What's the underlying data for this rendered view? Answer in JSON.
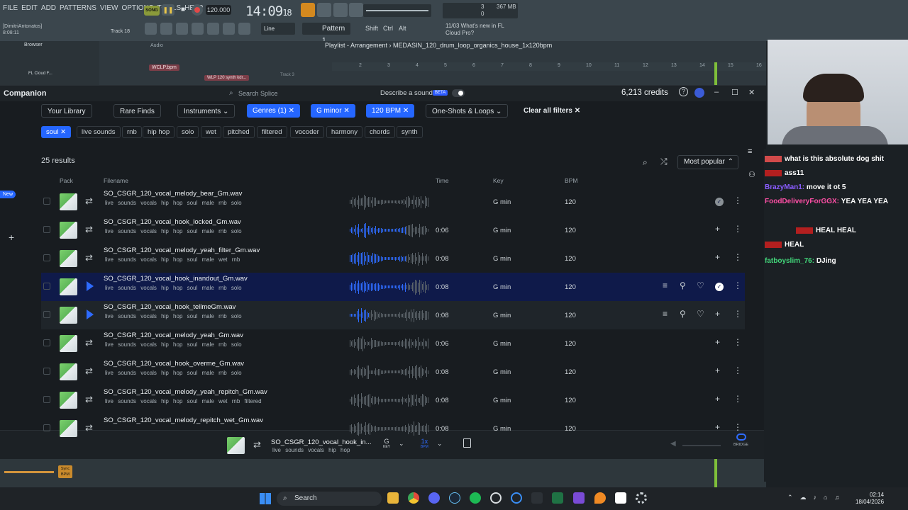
{
  "fl": {
    "menu": [
      "FILE",
      "EDIT",
      "ADD",
      "PATTERNS",
      "VIEW",
      "OPTIONS",
      "TOOLS",
      "HELP"
    ],
    "song_label": "SONG",
    "tempo": "120.000",
    "time": "14:09",
    "time_small": "18",
    "cpu": "3",
    "mem": "367 MB",
    "voices": "0",
    "user": "[DimitriAntonatos]",
    "user_time": "8:08:11",
    "track": "Track 18",
    "pattern": "Pattern 1",
    "line_mode": "Line",
    "news_date": "11/03",
    "news_text": "What's new in FL Cloud Pro?",
    "playlist_title": "Playlist - Arrangement",
    "project": "MEDASIN_120_drum_loop_organics_house_1x120bpm",
    "browser_label": "Browser",
    "audio_label": "Audio",
    "fl_cloud": "FL Cloud F...",
    "plugin1": "WCLP.bpm",
    "plugin2": "WLP 120 synth kdr...",
    "track3": "Track 3",
    "sync_bpm": "Sync BPM",
    "ruler": [
      "2",
      "3",
      "4",
      "5",
      "6",
      "7",
      "8",
      "9",
      "10",
      "11",
      "12",
      "13",
      "14",
      "15",
      "16"
    ]
  },
  "splice": {
    "title": "Companion",
    "search_placeholder": "Search Splice",
    "describe": "Describe a sound",
    "beta": "BETA",
    "credits": "6,213 credits",
    "filters": [
      {
        "label": "Your Library",
        "style": "outline"
      },
      {
        "label": "Rare Finds",
        "style": "outline"
      },
      {
        "label": "Instruments",
        "style": "outline"
      },
      {
        "label": "Genres (1)",
        "style": "blue"
      },
      {
        "label": "G minor",
        "style": "blue"
      },
      {
        "label": "120 BPM",
        "style": "blue"
      },
      {
        "label": "One-Shots & Loops",
        "style": "outline"
      }
    ],
    "clear_filters": "Clear all filters",
    "tags": [
      "soul",
      "live sounds",
      "rnb",
      "hip hop",
      "solo",
      "wet",
      "pitched",
      "filtered",
      "vocoder",
      "harmony",
      "chords",
      "synth"
    ],
    "active_tag": "soul",
    "results": "25 results",
    "sort": "Most popular",
    "columns": {
      "pack": "Pack",
      "filename": "Filename",
      "time": "Time",
      "key": "Key",
      "bpm": "BPM"
    },
    "rows": [
      {
        "name": "SO_CSGR_120_vocal_melody_bear_Gm.wav",
        "tags": "live sounds vocals hip hop soul male rnb solo",
        "time": "",
        "key": "G min",
        "bpm": "120",
        "state": "owned"
      },
      {
        "name": "SO_CSGR_120_vocal_hook_locked_Gm.wav",
        "tags": "live sounds vocals hip hop soul male rnb solo",
        "time": "0:06",
        "key": "G min",
        "bpm": "120",
        "state": "blue"
      },
      {
        "name": "SO_CSGR_120_vocal_melody_yeah_filter_Gm.wav",
        "tags": "live sounds vocals hip hop soul male wet rnb",
        "time": "0:08",
        "key": "G min",
        "bpm": "120",
        "state": "blue"
      },
      {
        "name": "SO_CSGR_120_vocal_hook_inandout_Gm.wav",
        "tags": "live sounds vocals hip hop soul male rnb solo",
        "time": "0:08",
        "key": "G min",
        "bpm": "120",
        "state": "selected"
      },
      {
        "name": "SO_CSGR_120_vocal_hook_tellmeGm.wav",
        "tags": "live sounds vocals hip hop soul male rnb solo",
        "time": "0:08",
        "key": "G min",
        "bpm": "120",
        "state": "hover"
      },
      {
        "name": "SO_CSGR_120_vocal_melody_yeah_Gm.wav",
        "tags": "live sounds vocals hip hop soul male rnb solo",
        "time": "0:06",
        "key": "G min",
        "bpm": "120",
        "state": "plain"
      },
      {
        "name": "SO_CSGR_120_vocal_hook_overme_Gm.wav",
        "tags": "live sounds vocals hip hop soul male rnb solo",
        "time": "0:08",
        "key": "G min",
        "bpm": "120",
        "state": "plain"
      },
      {
        "name": "SO_CSGR_120_vocal_melody_yeah_repitch_Gm.wav",
        "tags": "live sounds vocals hip hop soul male wet rnb filtered",
        "time": "0:08",
        "key": "G min",
        "bpm": "120",
        "state": "plain"
      },
      {
        "name": "SO_CSGR_120_vocal_melody_repitch_wet_Gm.wav",
        "tags": "",
        "time": "0:08",
        "key": "G min",
        "bpm": "120",
        "state": "plain"
      }
    ],
    "player": {
      "name": "SO_CSGR_120_vocal_hook_in...",
      "tags": "live sounds vocals hip hop",
      "key": "G",
      "key_label": "KEY",
      "bpm_mult": "1x",
      "bpm_label": "BPM",
      "bridge": "BRIDGE"
    },
    "new_badge": "New"
  },
  "chat": [
    {
      "user": "",
      "text": "what is this absolute dog shit",
      "color": "#d14a4a"
    },
    {
      "user": "",
      "text": "ass11",
      "color": "#b31f1f"
    },
    {
      "user": "BrazyMan1:",
      "text": "move it ot 5",
      "color": "#8a5cff"
    },
    {
      "user": "FoodDeliveryForGGX:",
      "text": "YEA YEA YEA",
      "color": "#ff4fa6"
    },
    {
      "user": "",
      "text": "HEAL HEAL",
      "color": "#b31f1f"
    },
    {
      "user": "",
      "text": "HEAL",
      "color": "#b31f1f"
    },
    {
      "user": "fatboyslim_76:",
      "text": "DJing",
      "color": "#42d67a"
    }
  ],
  "taskbar": {
    "search": "Search",
    "time": "02:14",
    "date": "18/04/2026"
  },
  "colors": {
    "accent": "#2566ff",
    "selected_row": "#0f1a4a",
    "wave_active": "#2e6bff"
  }
}
